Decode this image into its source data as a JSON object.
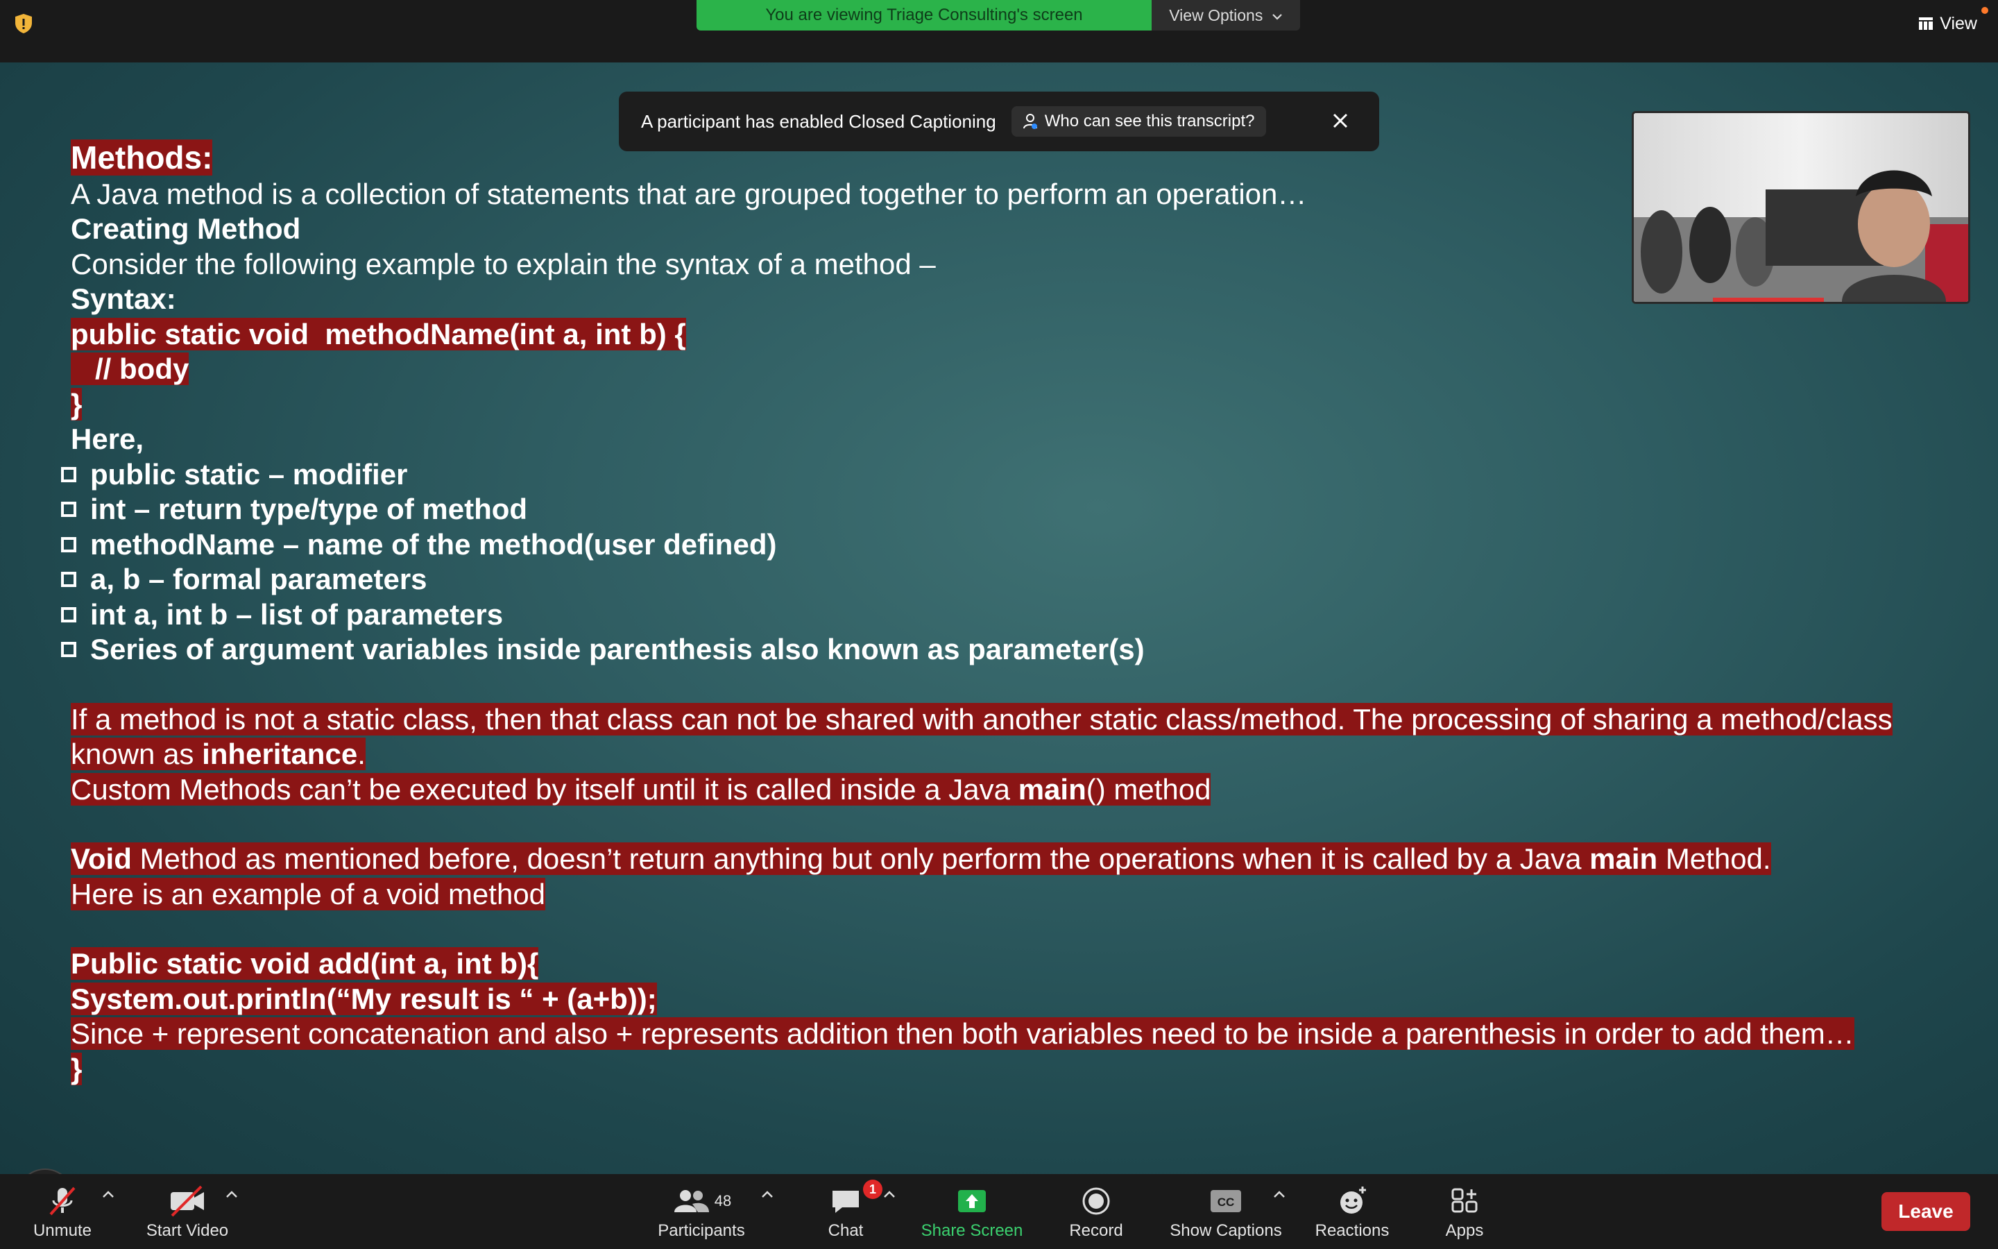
{
  "banner": {
    "viewing_text": "You are viewing Triage Consulting's screen",
    "view_options_label": "View Options"
  },
  "top_right": {
    "view_label": "View"
  },
  "cc_toast": {
    "message": "A participant has enabled Closed Captioning",
    "who_label": "Who can see this transcript?"
  },
  "slide": {
    "title": "Methods:",
    "intro": "A Java method is a collection of statements that are grouped together to perform an operation…",
    "creating": "Creating Method",
    "consider": "Consider the following example to explain the syntax of a method –",
    "syntax_label": "Syntax:",
    "code1": "public static void  methodName(int a, int b) {",
    "code2": "   // body",
    "code3": "}",
    "here": "Here,",
    "bullets": [
      "public static – modifier",
      "int – return type/type of method",
      "methodName – name of the method(user defined)",
      "a, b – formal parameters",
      "int a, int b – list of parameters",
      "Series of argument variables inside parenthesis also known as parameter(s)"
    ],
    "p1_a": "If a method is not a static class, then that class can not be shared with another static class/method. The processing of sharing a method/class known as ",
    "p1_b": "inheritance",
    "p1_c": ".",
    "p2_a": "Custom Methods can’t be executed by itself until it is called inside a Java ",
    "p2_b": "main",
    "p2_c": "() method",
    "p3_a": "Void",
    "p3_b": " Method as mentioned before, doesn’t return anything but only perform the operations when it is called by a Java ",
    "p3_c": "main",
    "p3_d": " Method.",
    "p4": "Here is an example of a void method",
    "ex1": "Public static void add(int a, int b){",
    "ex2": "System.out.println(“My result is “ + (a+b));",
    "ex3": "Since + represent concatenation and also + represents addition then both variables need to be inside a parenthesis in order to add them…",
    "ex4": "}"
  },
  "toolbar": {
    "unmute": "Unmute",
    "start_video": "Start Video",
    "participants": "Participants",
    "participant_count": "48",
    "chat": "Chat",
    "chat_badge": "1",
    "share_screen": "Share Screen",
    "record": "Record",
    "show_captions": "Show Captions",
    "cc_text": "CC",
    "reactions": "Reactions",
    "apps": "Apps",
    "leave": "Leave"
  },
  "colors": {
    "banner_green": "#2bb34a",
    "highlight_red": "#8b1515",
    "leave_red": "#c0282a",
    "share_green": "#22b14c"
  }
}
